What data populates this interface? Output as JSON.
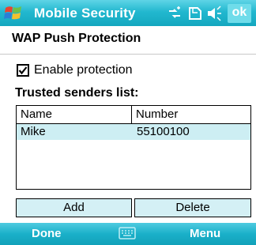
{
  "titlebar": {
    "title": "Mobile Security",
    "ok_label": "ok",
    "icons": [
      "start-icon",
      "connectivity-icon",
      "battery-icon",
      "volume-icon"
    ]
  },
  "page": {
    "title": "WAP Push Protection"
  },
  "protection": {
    "checkbox_label": "Enable protection",
    "checked": true
  },
  "trusted": {
    "section_label": "Trusted senders list:",
    "columns": [
      "Name",
      "Number"
    ],
    "rows": [
      {
        "name": "Mike",
        "number": "55100100"
      }
    ]
  },
  "actions": {
    "add_label": "Add",
    "delete_label": "Delete"
  },
  "softkeys": {
    "left_label": "Done",
    "right_label": "Menu",
    "center_icon": "keyboard-icon"
  },
  "colors": {
    "accent": "#1ab0c9",
    "selection": "#cdeef3"
  }
}
